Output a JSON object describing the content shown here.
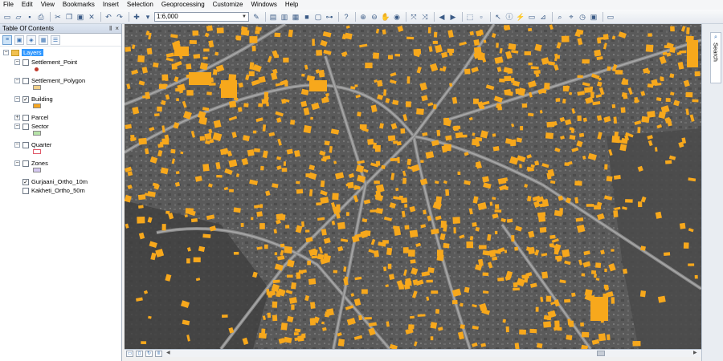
{
  "menu": {
    "items": [
      "File",
      "Edit",
      "View",
      "Bookmarks",
      "Insert",
      "Selection",
      "Geoprocessing",
      "Customize",
      "Windows",
      "Help"
    ]
  },
  "toolbar": {
    "scale_value": "1:6,000",
    "icons": [
      "new-document",
      "open",
      "save",
      "print",
      "cut",
      "copy",
      "paste",
      "delete",
      "undo",
      "redo",
      "add-data",
      "scale",
      "editor",
      "table",
      "catalog",
      "search",
      "arctoolbox",
      "python",
      "model",
      "help",
      "zoom-in",
      "zoom-out",
      "pan",
      "full-extent",
      "fixed-zoom-in",
      "fixed-zoom-out",
      "back",
      "forward",
      "select",
      "identify",
      "find",
      "go-to-xy",
      "measure",
      "hyperlink",
      "html-popup",
      "time-slider",
      "viewer"
    ]
  },
  "toc": {
    "title": "Table Of Contents",
    "pin_symbol": "‖",
    "close_symbol": "×",
    "root": "Layers",
    "layers": [
      {
        "name": "Settlement_Point",
        "checked": false,
        "expanded": true,
        "symbol": "point",
        "color": "#c0392b"
      },
      {
        "name": "Settlement_Polygon",
        "checked": false,
        "expanded": true,
        "symbol": "polygon",
        "color": "#f1d08a"
      },
      {
        "name": "Building",
        "checked": true,
        "expanded": true,
        "symbol": "polygon",
        "color": "#f5a623"
      },
      {
        "name": "Parcel",
        "checked": false,
        "expanded": false,
        "symbol": "none",
        "color": ""
      },
      {
        "name": "Sector",
        "checked": false,
        "expanded": true,
        "symbol": "polygon",
        "color": "#b6e3a8"
      },
      {
        "name": "Quarter",
        "checked": false,
        "expanded": true,
        "symbol": "outline",
        "color": "#e05a6a"
      },
      {
        "name": "Zones",
        "checked": false,
        "expanded": true,
        "symbol": "polygon",
        "color": "#d4c7ef"
      },
      {
        "name": "Gurjaani_Ortho_10m",
        "checked": true,
        "expanded": false,
        "symbol": "none",
        "color": ""
      },
      {
        "name": "Kakheti_Ortho_50m",
        "checked": false,
        "expanded": false,
        "symbol": "none",
        "color": ""
      }
    ]
  },
  "search_panel": {
    "label": "Search"
  },
  "colors": {
    "building": "#f7a81c",
    "selection_blue": "#3399ff",
    "map_base": "#5f5f5f"
  }
}
